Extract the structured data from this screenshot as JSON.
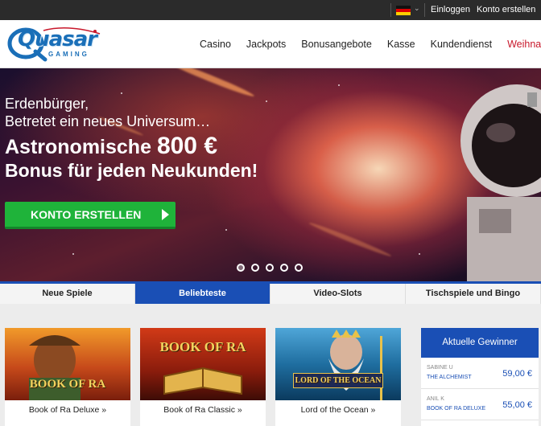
{
  "topbar": {
    "language": "DE",
    "login_label": "Einloggen",
    "register_label": "Konto erstellen"
  },
  "logo": {
    "wordmark": "Quasar",
    "subtitle": "GAMING"
  },
  "nav": {
    "items": [
      {
        "label": "Casino"
      },
      {
        "label": "Jackpots"
      },
      {
        "label": "Bonusangebote"
      },
      {
        "label": "Kasse"
      },
      {
        "label": "Kundendienst"
      },
      {
        "label": "Weihnachten"
      }
    ]
  },
  "hero": {
    "line1": "Erdenbürger,",
    "line2": "Betretet ein neues Universum…",
    "line3_prefix": "Astronomische ",
    "line3_amount": "800 €",
    "line4": "Bonus für jeden Neukunden!",
    "cta_label": "KONTO ERSTELLEN",
    "slides": 5,
    "active_slide": 0
  },
  "tabs": [
    {
      "label": "Neue Spiele",
      "active": false
    },
    {
      "label": "Beliebteste",
      "active": true
    },
    {
      "label": "Video-Slots",
      "active": false
    },
    {
      "label": "Tischspiele und Bingo",
      "active": false
    }
  ],
  "games": [
    {
      "title_art": "BOOK OF RA",
      "label": "Book of Ra Deluxe »"
    },
    {
      "title_art": "BOOK OF RA",
      "label": "Book of Ra Classic »"
    },
    {
      "title_art": "LORD OF THE OCEAN",
      "label": "Lord of the Ocean »"
    }
  ],
  "winners": {
    "title": "Aktuelle Gewinner",
    "rows": [
      {
        "name": "SABINE U",
        "game": "THE ALCHEMIST",
        "amount": "59,00 €"
      },
      {
        "name": "ANIL K",
        "game": "BOOK OF RA DELUXE",
        "amount": "55,00 €"
      }
    ]
  },
  "colors": {
    "brand_blue": "#1a4fb5",
    "cta_green": "#1fb33a",
    "xmas_red": "#c8182b",
    "topbar": "#2b2b2b"
  }
}
